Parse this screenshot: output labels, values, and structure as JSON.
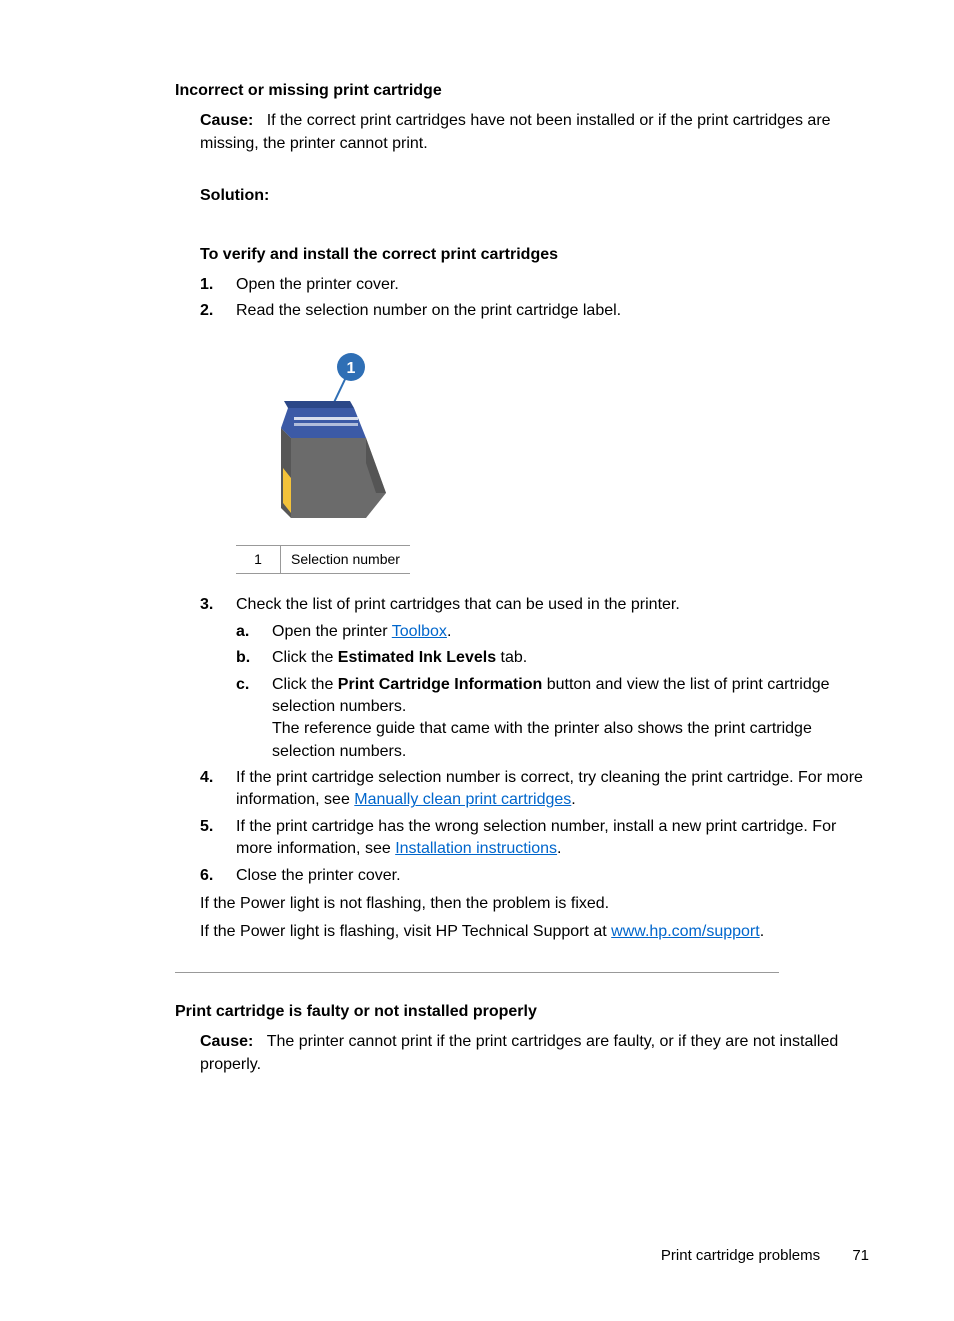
{
  "section1": {
    "title": "Incorrect or missing print cartridge",
    "cause_label": "Cause:",
    "cause_text": "If the correct print cartridges have not been installed or if the print cartridges are missing, the printer cannot print.",
    "solution_label": "Solution:",
    "steps_heading": "To verify and install the correct print cartridges",
    "step1_num": "1.",
    "step1": "Open the printer cover.",
    "step2_num": "2.",
    "step2": "Read the selection number on the print cartridge label.",
    "callout_num": "1",
    "callout_text": "Selection number",
    "step3_num": "3.",
    "step3": "Check the list of print cartridges that can be used in the printer.",
    "step3a_alpha": "a",
    "step3a_pre": "Open the printer ",
    "step3a_link": "Toolbox",
    "step3a_post": ".",
    "step3b_alpha": "b",
    "step3b_pre": "Click the ",
    "step3b_bold": "Estimated Ink Levels",
    "step3b_post": " tab.",
    "step3c_alpha": "c",
    "step3c_pre": "Click the ",
    "step3c_bold": "Print Cartridge Information",
    "step3c_post": " button and view the list of print cartridge selection numbers.",
    "step3c_line2": "The reference guide that came with the printer also shows the print cartridge selection numbers.",
    "step4_num": "4.",
    "step4_pre": "If the print cartridge selection number is correct, try cleaning the print cartridge. For more information, see ",
    "step4_link": "Manually clean print cartridges",
    "step4_post": ".",
    "step5_num": "5.",
    "step5_pre": "If the print cartridge has the wrong selection number, install a new print cartridge. For more information, see ",
    "step5_link": "Installation instructions",
    "step5_post": ".",
    "step6_num": "6.",
    "step6": "Close the printer cover.",
    "after1": "If the Power light is not flashing, then the problem is fixed.",
    "after2_pre": "If the Power light is flashing, visit HP Technical Support at ",
    "after2_link": "www.hp.com/support",
    "after2_post": "."
  },
  "section2": {
    "title": "Print cartridge is faulty or not installed properly",
    "cause_label": "Cause:",
    "cause_text": "The printer cannot print if the print cartridges are faulty, or if they are not installed properly."
  },
  "footer": {
    "text": "Print cartridge problems",
    "page": "71"
  }
}
